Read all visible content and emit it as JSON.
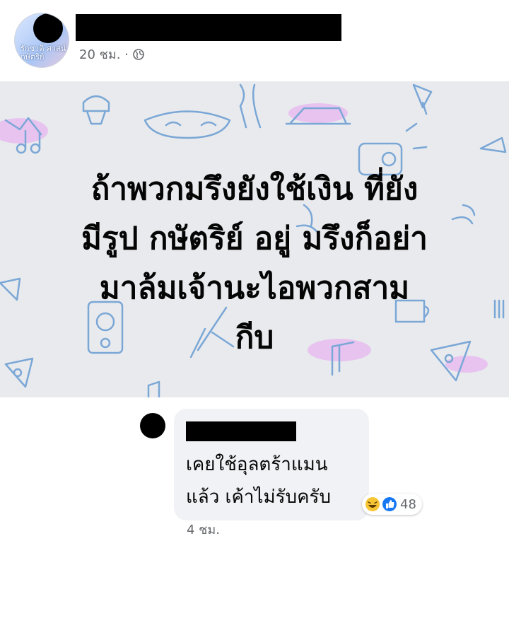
{
  "post": {
    "avatar_text": "รักชาติ ศาสน์ กษัตริย์",
    "timestamp": "20 ชม. ·",
    "text_lines": [
      "ถ้าพวกมรึงยังใช้เงิน ที่ยัง",
      "มีรูป กษัตริย์ อยู่ มรึงก็อย่า",
      "มาล้มเจ้านะไอพวกสาม",
      "กีบ"
    ],
    "background_color": "#e9eaed",
    "doodle_color": "#7aa7d6",
    "accent_color": "#d98be6"
  },
  "comment": {
    "text_lines": [
      "เคยใช้อุลตร้าแมน",
      "แล้ว เค้าไม่รับครับ"
    ],
    "reaction_count": "48",
    "timestamp": "4 ชม.",
    "reaction_icons": [
      "haha-icon",
      "like-icon"
    ]
  }
}
